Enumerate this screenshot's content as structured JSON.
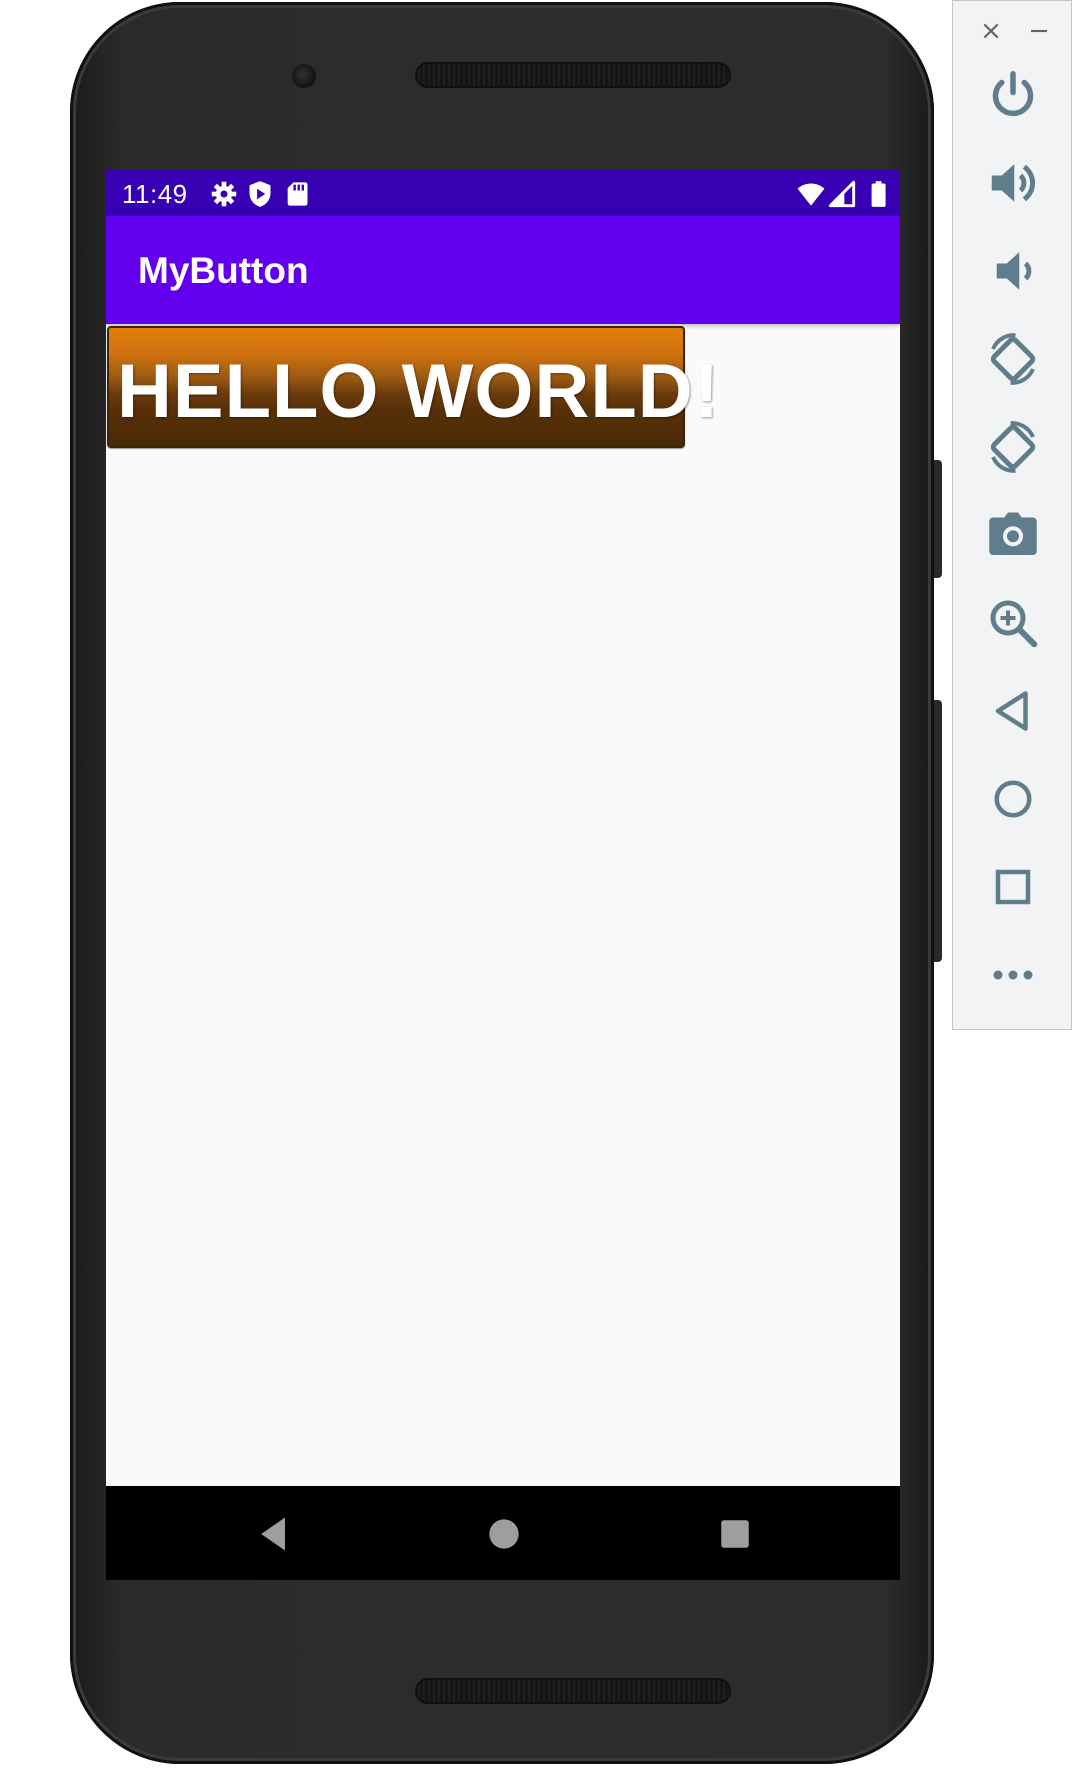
{
  "status_bar": {
    "time": "11:49",
    "left_icons": [
      "settings-icon",
      "shield-play-icon",
      "sd-card-icon"
    ],
    "right_icons": [
      "wifi-icon",
      "cell-signal-icon",
      "battery-icon"
    ]
  },
  "app_bar": {
    "title": "MyButton"
  },
  "main": {
    "button_label": "HELLO WORLD!"
  },
  "nav_bar": {
    "buttons": [
      "back-icon",
      "home-icon",
      "recents-icon"
    ]
  },
  "emulator_panel": {
    "window_controls": [
      "close-icon",
      "minimize-icon"
    ],
    "tools": [
      "power-icon",
      "volume-up-icon",
      "volume-down-icon",
      "rotate-left-icon",
      "rotate-right-icon",
      "camera-icon",
      "zoom-icon",
      "back-icon",
      "home-icon",
      "overview-icon",
      "more-icon"
    ]
  },
  "colors": {
    "status_bar": "#3700b3",
    "app_bar": "#6200ee",
    "button_top": "#e27f0a",
    "button_bottom": "#4a2906",
    "panel_icon": "#607d8b"
  }
}
